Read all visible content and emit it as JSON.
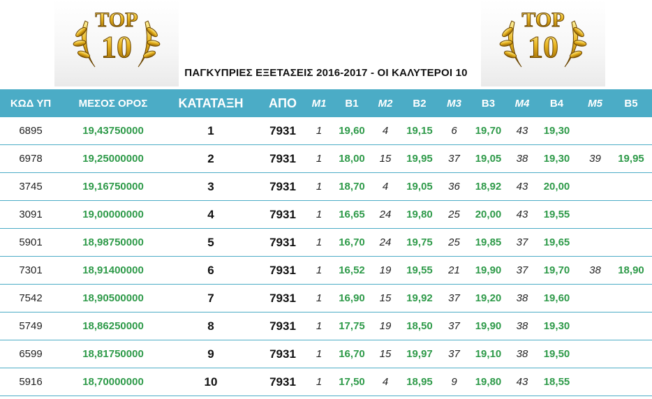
{
  "title": "ΠΑΓΚΥΠΡΙΕΣ ΕΞΕΤΑΣΕΙΣ 2016-2017 - ΟΙ ΚΑΛΥΤΕΡΟΙ 10",
  "badge": {
    "top": "TOP",
    "number": "10",
    "icon": "laurel-trophy-icon"
  },
  "colors": {
    "header_bg": "#4bacc6",
    "green": "#2e9a49"
  },
  "headers": [
    "ΚΩΔ ΥΠ",
    "ΜΕΣΟΣ ΟΡΟΣ",
    "ΚΑΤΑΤΑΞΗ",
    "ΑΠΟ",
    "Μ1",
    "Β1",
    "Μ2",
    "Β2",
    "Μ3",
    "Β3",
    "Μ4",
    "Β4",
    "Μ5",
    "Β5"
  ],
  "rows": [
    {
      "code": "6895",
      "avg": "19,43750000",
      "rank": "1",
      "apo": "7931",
      "m1": "1",
      "b1": "19,60",
      "m2": "4",
      "b2": "19,15",
      "m3": "6",
      "b3": "19,70",
      "m4": "43",
      "b4": "19,30",
      "m5": "",
      "b5": ""
    },
    {
      "code": "6978",
      "avg": "19,25000000",
      "rank": "2",
      "apo": "7931",
      "m1": "1",
      "b1": "18,00",
      "m2": "15",
      "b2": "19,95",
      "m3": "37",
      "b3": "19,05",
      "m4": "38",
      "b4": "19,30",
      "m5": "39",
      "b5": "19,95"
    },
    {
      "code": "3745",
      "avg": "19,16750000",
      "rank": "3",
      "apo": "7931",
      "m1": "1",
      "b1": "18,70",
      "m2": "4",
      "b2": "19,05",
      "m3": "36",
      "b3": "18,92",
      "m4": "43",
      "b4": "20,00",
      "m5": "",
      "b5": ""
    },
    {
      "code": "3091",
      "avg": "19,00000000",
      "rank": "4",
      "apo": "7931",
      "m1": "1",
      "b1": "16,65",
      "m2": "24",
      "b2": "19,80",
      "m3": "25",
      "b3": "20,00",
      "m4": "43",
      "b4": "19,55",
      "m5": "",
      "b5": ""
    },
    {
      "code": "5901",
      "avg": "18,98750000",
      "rank": "5",
      "apo": "7931",
      "m1": "1",
      "b1": "16,70",
      "m2": "24",
      "b2": "19,75",
      "m3": "25",
      "b3": "19,85",
      "m4": "37",
      "b4": "19,65",
      "m5": "",
      "b5": ""
    },
    {
      "code": "7301",
      "avg": "18,91400000",
      "rank": "6",
      "apo": "7931",
      "m1": "1",
      "b1": "16,52",
      "m2": "19",
      "b2": "19,55",
      "m3": "21",
      "b3": "19,90",
      "m4": "37",
      "b4": "19,70",
      "m5": "38",
      "b5": "18,90"
    },
    {
      "code": "7542",
      "avg": "18,90500000",
      "rank": "7",
      "apo": "7931",
      "m1": "1",
      "b1": "16,90",
      "m2": "15",
      "b2": "19,92",
      "m3": "37",
      "b3": "19,20",
      "m4": "38",
      "b4": "19,60",
      "m5": "",
      "b5": ""
    },
    {
      "code": "5749",
      "avg": "18,86250000",
      "rank": "8",
      "apo": "7931",
      "m1": "1",
      "b1": "17,75",
      "m2": "19",
      "b2": "18,50",
      "m3": "37",
      "b3": "19,90",
      "m4": "38",
      "b4": "19,30",
      "m5": "",
      "b5": ""
    },
    {
      "code": "6599",
      "avg": "18,81750000",
      "rank": "9",
      "apo": "7931",
      "m1": "1",
      "b1": "16,70",
      "m2": "15",
      "b2": "19,97",
      "m3": "37",
      "b3": "19,10",
      "m4": "38",
      "b4": "19,50",
      "m5": "",
      "b5": ""
    },
    {
      "code": "5916",
      "avg": "18,70000000",
      "rank": "10",
      "apo": "7931",
      "m1": "1",
      "b1": "17,50",
      "m2": "4",
      "b2": "18,95",
      "m3": "9",
      "b3": "19,80",
      "m4": "43",
      "b4": "18,55",
      "m5": "",
      "b5": ""
    }
  ]
}
